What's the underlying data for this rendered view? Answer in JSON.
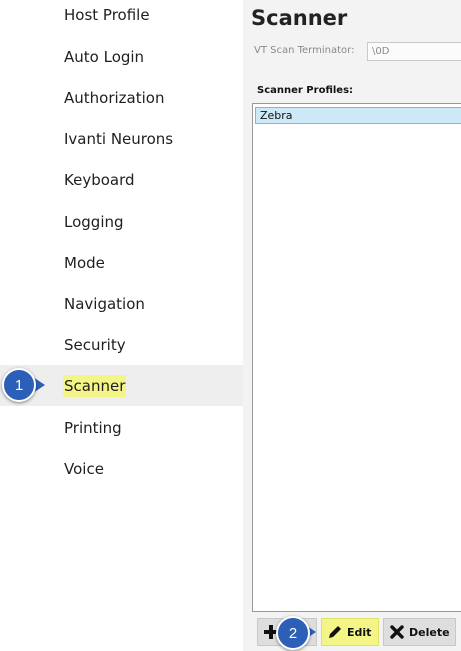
{
  "sidebar": {
    "items": [
      {
        "label": "Host Profile"
      },
      {
        "label": "Auto Login"
      },
      {
        "label": "Authorization"
      },
      {
        "label": "Ivanti Neurons"
      },
      {
        "label": "Keyboard"
      },
      {
        "label": "Logging"
      },
      {
        "label": "Mode"
      },
      {
        "label": "Navigation"
      },
      {
        "label": "Security"
      },
      {
        "label": "Scanner",
        "selected": true
      },
      {
        "label": "Printing"
      },
      {
        "label": "Voice"
      }
    ]
  },
  "main": {
    "title": "Scanner",
    "vt_scan_terminator": {
      "label": "VT Scan Terminator:",
      "value": "\\0D"
    },
    "scanner_profiles": {
      "label": "Scanner Profiles:",
      "items": [
        "Zebra"
      ]
    },
    "buttons": {
      "add": "",
      "edit": "Edit",
      "delete": "Delete"
    }
  },
  "callouts": {
    "one": "1",
    "two": "2"
  },
  "colors": {
    "highlight": "#f3f586",
    "selection_bg": "#cde8f7",
    "badge": "#2c5fb8"
  },
  "icons": [
    "plus-icon",
    "pencil-icon",
    "x-icon"
  ]
}
